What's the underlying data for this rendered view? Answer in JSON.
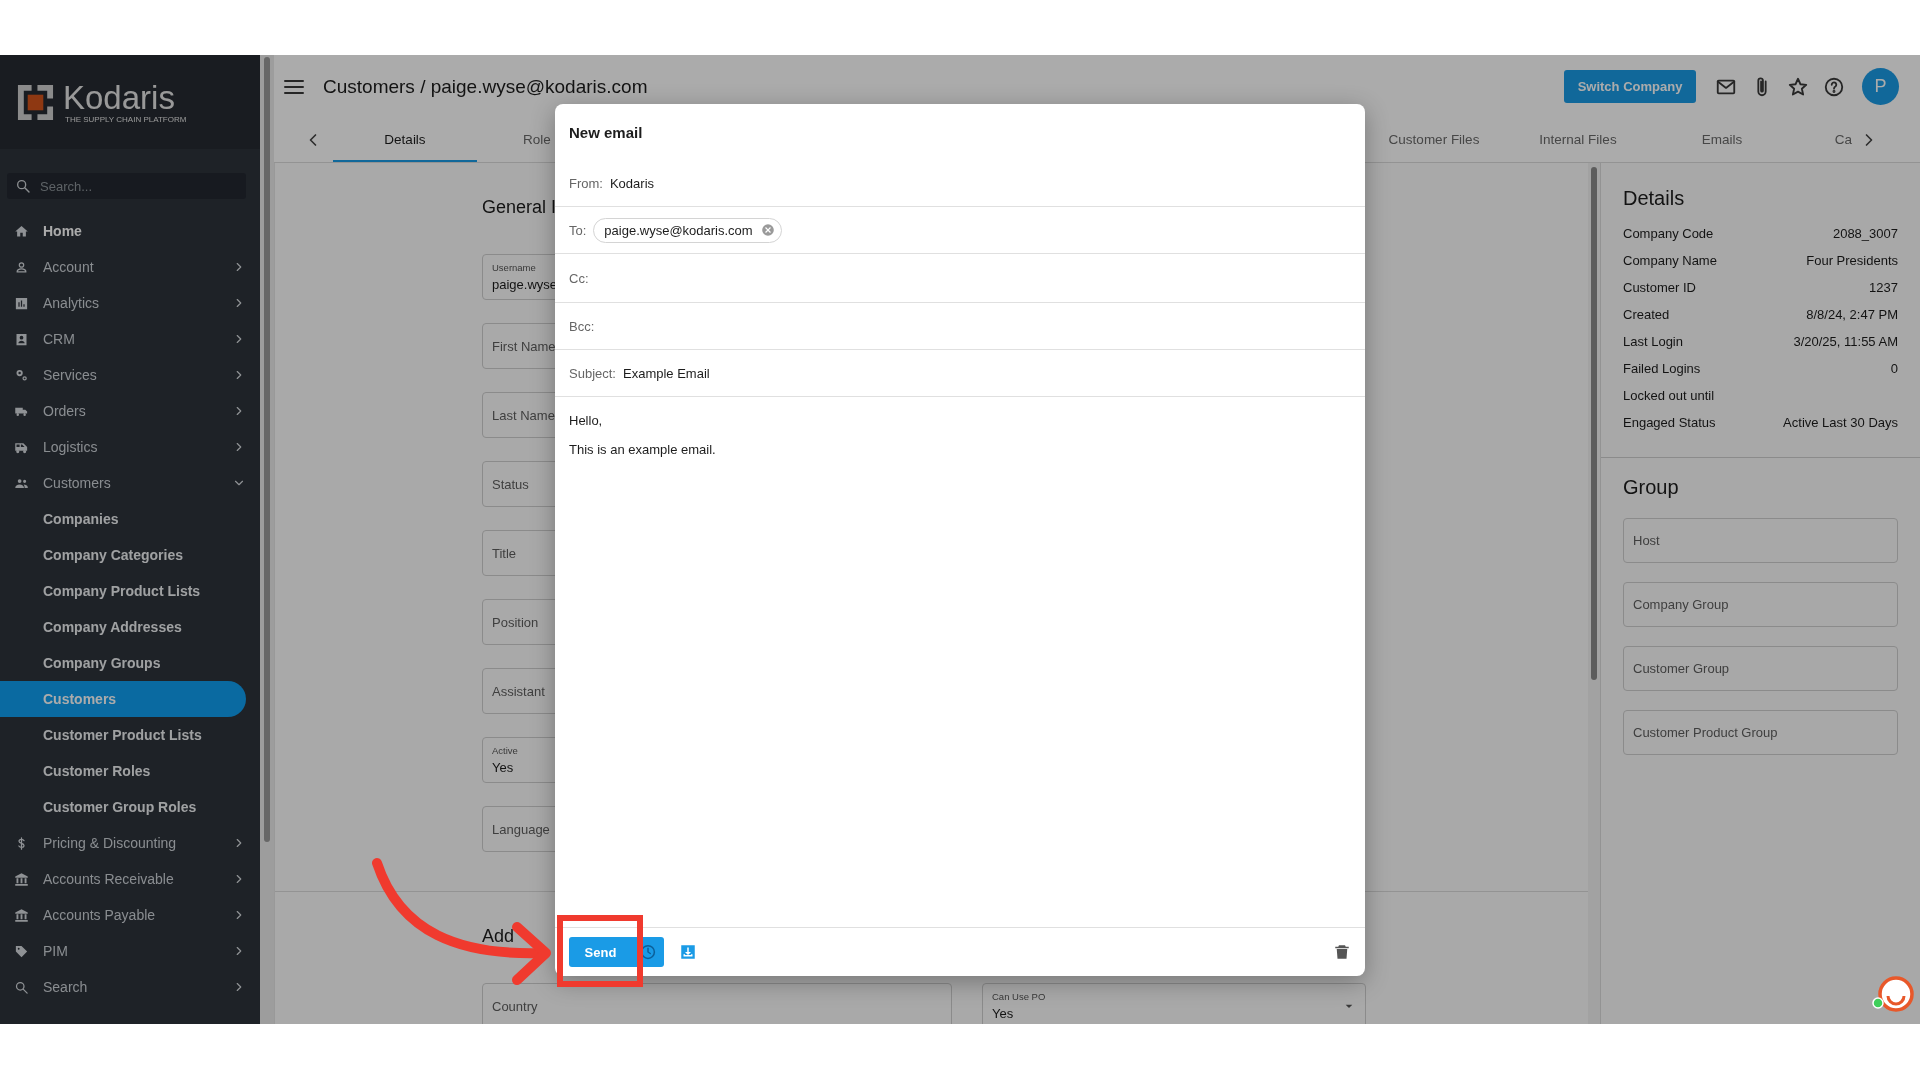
{
  "sidebar": {
    "logo": {
      "name": "Kodaris",
      "tagline": "THE SUPPLY CHAIN PLATFORM"
    },
    "search": {
      "placeholder": "Search..."
    },
    "items": [
      {
        "label": "Home",
        "kind": "link",
        "selected": false
      },
      {
        "label": "Account",
        "kind": "group",
        "expanded": false,
        "selected": false
      },
      {
        "label": "Analytics",
        "kind": "group",
        "expanded": false,
        "selected": false
      },
      {
        "label": "CRM",
        "kind": "group",
        "expanded": false,
        "selected": false
      },
      {
        "label": "Services",
        "kind": "group",
        "expanded": false,
        "selected": false
      },
      {
        "label": "Orders",
        "kind": "group",
        "expanded": false,
        "selected": false
      },
      {
        "label": "Logistics",
        "kind": "group",
        "expanded": false,
        "selected": false
      },
      {
        "label": "Customers",
        "kind": "group",
        "expanded": true,
        "selected": false,
        "children": [
          {
            "label": "Companies",
            "selected": false
          },
          {
            "label": "Company Categories",
            "selected": false
          },
          {
            "label": "Company Product Lists",
            "selected": false
          },
          {
            "label": "Company Addresses",
            "selected": false
          },
          {
            "label": "Company Groups",
            "selected": false
          },
          {
            "label": "Customers",
            "selected": true
          },
          {
            "label": "Customer Product Lists",
            "selected": false
          },
          {
            "label": "Customer Roles",
            "selected": false
          },
          {
            "label": "Customer Group Roles",
            "selected": false
          }
        ]
      },
      {
        "label": "Pricing & Discounting",
        "kind": "group",
        "expanded": false,
        "selected": false
      },
      {
        "label": "Accounts Receivable",
        "kind": "group",
        "expanded": false,
        "selected": false
      },
      {
        "label": "Accounts Payable",
        "kind": "group",
        "expanded": false,
        "selected": false
      },
      {
        "label": "PIM",
        "kind": "group",
        "expanded": false,
        "selected": false
      },
      {
        "label": "Search",
        "kind": "group",
        "expanded": false,
        "selected": false
      }
    ]
  },
  "header": {
    "title": "Customers / paige.wyse@kodaris.com",
    "button": "Switch Company",
    "avatar": "P"
  },
  "tabs": {
    "start": [
      {
        "label": "Details",
        "selected": true
      },
      {
        "label": "Role",
        "selected": false
      }
    ],
    "end": [
      {
        "label": "Customer Files",
        "selected": false
      },
      {
        "label": "Internal Files",
        "selected": false
      },
      {
        "label": "Emails",
        "selected": false
      },
      {
        "label": "Ca",
        "selected": false
      }
    ]
  },
  "form": {
    "heading": "General I",
    "fields": [
      {
        "label": "Username",
        "value": "paige.wyse"
      },
      {
        "label": "First Name"
      },
      {
        "label": "Last Name"
      },
      {
        "label": "Status"
      },
      {
        "label": "Title"
      },
      {
        "label": "Position"
      },
      {
        "label": "Assistant"
      },
      {
        "label": "Active",
        "value": "Yes"
      },
      {
        "label": "Language"
      }
    ],
    "section_heading": "Add",
    "section_fields": [
      {
        "label": "Country",
        "kind": "text"
      },
      {
        "label": "Can Use PO",
        "value": "Yes",
        "kind": "select"
      }
    ]
  },
  "details": {
    "heading": "Details",
    "rows": [
      {
        "label": "Company Code",
        "value": "2088_3007"
      },
      {
        "label": "Company Name",
        "value": "Four Presidents"
      },
      {
        "label": "Customer ID",
        "value": "1237"
      },
      {
        "label": "Created",
        "value": "8/8/24, 2:47 PM"
      },
      {
        "label": "Last Login",
        "value": "3/20/25, 11:55 AM"
      },
      {
        "label": "Failed Logins",
        "value": "0"
      },
      {
        "label": "Locked out until"
      },
      {
        "label": "Engaged Status",
        "value": "Active Last 30 Days"
      }
    ]
  },
  "group": {
    "heading": "Group",
    "fields": [
      {
        "label": "Host"
      },
      {
        "label": "Company Group"
      },
      {
        "label": "Customer Group"
      },
      {
        "label": "Customer Product Group"
      }
    ]
  },
  "email_dialog": {
    "title": "New email",
    "from": {
      "label": "From:",
      "value": "Kodaris"
    },
    "to": {
      "label": "To:",
      "recipients": [
        "paige.wyse@kodaris.com"
      ]
    },
    "cc": {
      "label": "Cc:"
    },
    "bcc": {
      "label": "Bcc:"
    },
    "subject": {
      "label": "Subject:",
      "value": "Example Email"
    },
    "body": [
      "Hello,",
      "This is an example email."
    ],
    "send_button": "Send"
  }
}
